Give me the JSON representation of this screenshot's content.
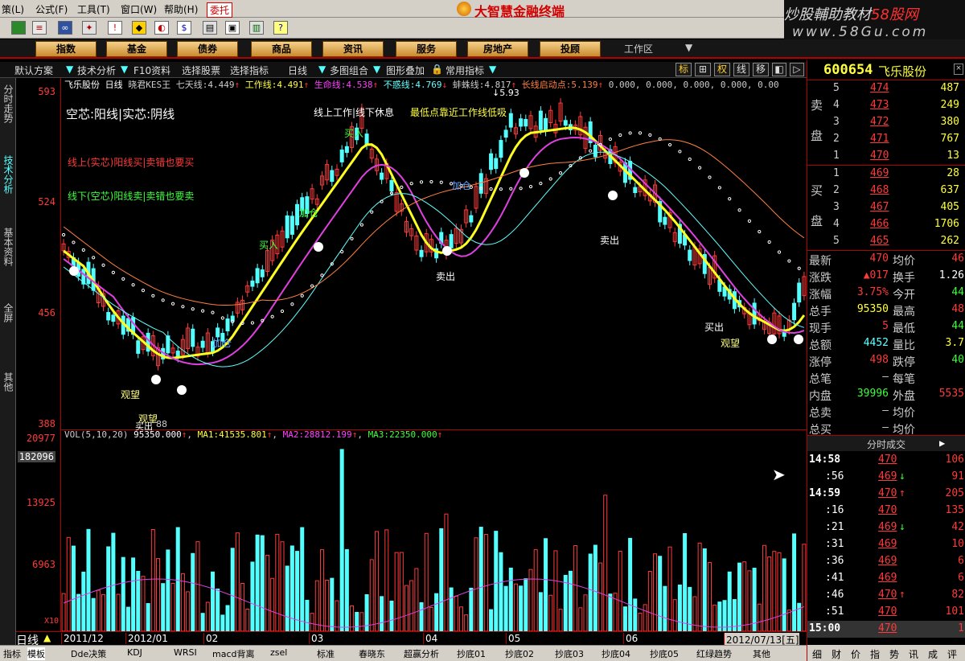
{
  "menubar": {
    "items": [
      "策(L)",
      "公式(F)",
      "工具(T)",
      "窗口(W)",
      "帮助(H)"
    ],
    "sell_tab": "委托",
    "app_title": "大智慧金融终端",
    "watermark_line1a": "炒股輔助教材",
    "watermark_line1b": "58股网",
    "watermark_line2": "www.58Gu.com"
  },
  "navbar": {
    "buttons": [
      "指数",
      "基金",
      "债券",
      "商品",
      "资讯",
      "服务",
      "房地产",
      "投顾"
    ],
    "workspace": "工作区"
  },
  "toolbar2": {
    "items": [
      "默认方案",
      "技术分析",
      "F10资料",
      "选择股票",
      "选择指标",
      "日线",
      "多图组合",
      "图形叠加",
      "常用指标"
    ],
    "right_btns": [
      "标",
      "⊞",
      "权",
      "线",
      "移"
    ]
  },
  "sidebar": {
    "tabs": [
      "分时走势",
      "技术分析",
      "基本资料",
      "全屏",
      "其他"
    ]
  },
  "yaxis": {
    "labels": [
      "593",
      "524",
      "456",
      "388"
    ],
    "vol_labels": [
      "20977",
      "182096",
      "13925",
      "6963",
      "X10"
    ]
  },
  "indicator_line": {
    "name": "飞乐股份 日线",
    "formula": "晓君KES王",
    "items": [
      {
        "label": "七天线:",
        "value": "4.449",
        "color": "#ccc"
      },
      {
        "label": "工作线:",
        "value": "4.491",
        "color": "#ffff40"
      },
      {
        "label": "生命线:",
        "value": "4.538",
        "color": "#ff40ff"
      },
      {
        "label": "不惑线:",
        "value": "4.769",
        "color": "#60ffff"
      },
      {
        "label": "蚌蛛线:",
        "value": "4.817",
        "color": "#ccc"
      },
      {
        "label": "长线启动点:",
        "value": "5.139",
        "color": "#ff8040"
      }
    ],
    "tail": "0.000, 0.000, 0.000, 0.000, 0.00",
    "marker": "5.93"
  },
  "chart_annotations": {
    "hollow_solid": "空芯:阳线|实芯:阴线",
    "above_below": "线上工作|线下休息",
    "lowest_point": "最低点靠近工作线低吸",
    "line_up": "线上(实芯)阳线买|卖错也要买",
    "line_down": "线下(空芯)阳线卖|卖错也要卖",
    "labels": [
      "卖出",
      "卖出",
      "观望",
      "观望",
      "观望",
      "买出",
      "买入",
      "买入",
      "加仓",
      "加仓",
      "加仓",
      "买出",
      "88"
    ]
  },
  "volume": {
    "label": "VOL(5,10,20)",
    "value": "95350.000",
    "ma1_label": "MA1:",
    "ma1": "41535.801",
    "ma2_label": "MA2:",
    "ma2": "28812.199",
    "ma3_label": "MA3:",
    "ma3": "22350.000"
  },
  "xaxis": {
    "period": "日线",
    "labels": [
      "2011/12",
      "2012/01",
      "02",
      "03",
      "04",
      "05",
      "06",
      "2012/07/13[五]"
    ]
  },
  "bottom_tabs": [
    "指标",
    "模板",
    "Dde决策",
    "KDJ",
    "WRSI",
    "macd背离",
    "zsel",
    "标准",
    "春晓东",
    "超赢分析",
    "抄底01",
    "抄底02",
    "抄底03",
    "抄底04",
    "抄底05",
    "红绿趋势",
    "其他"
  ],
  "quote": {
    "code": "600654",
    "name": "飞乐股份",
    "sell_label": [
      "卖",
      "盘"
    ],
    "buy_label": [
      "买",
      "盘"
    ],
    "asks": [
      {
        "lvl": "5",
        "price": "474",
        "vol": "487"
      },
      {
        "lvl": "4",
        "price": "473",
        "vol": "249"
      },
      {
        "lvl": "3",
        "price": "472",
        "vol": "380"
      },
      {
        "lvl": "2",
        "price": "471",
        "vol": "767"
      },
      {
        "lvl": "1",
        "price": "470",
        "vol": "13"
      }
    ],
    "bids": [
      {
        "lvl": "1",
        "price": "469",
        "vol": "28"
      },
      {
        "lvl": "2",
        "price": "468",
        "vol": "637"
      },
      {
        "lvl": "3",
        "price": "467",
        "vol": "405"
      },
      {
        "lvl": "4",
        "price": "466",
        "vol": "1706"
      },
      {
        "lvl": "5",
        "price": "465",
        "vol": "262"
      }
    ],
    "stats": [
      {
        "l1": "最新",
        "v1": "470",
        "c1": "redv",
        "l2": "均价",
        "v2": "46",
        "c2": "redv"
      },
      {
        "l1": "涨跌",
        "v1": "▲017",
        "c1": "redv",
        "l2": "换手",
        "v2": "1.26",
        "c2": "whv"
      },
      {
        "l1": "涨幅",
        "v1": "3.75%",
        "c1": "redv",
        "l2": "今开",
        "v2": "44",
        "c2": "grnv"
      },
      {
        "l1": "总手",
        "v1": "95350",
        "c1": "yelv",
        "l2": "最高",
        "v2": "48",
        "c2": "redv"
      },
      {
        "l1": "现手",
        "v1": "5",
        "c1": "redv",
        "l2": "最低",
        "v2": "44",
        "c2": "grnv"
      },
      {
        "l1": "总额",
        "v1": "4452",
        "c1": "cyv",
        "l2": "量比",
        "v2": "3.7",
        "c2": "yelv"
      },
      {
        "l1": "涨停",
        "v1": "498",
        "c1": "redv",
        "l2": "跌停",
        "v2": "40",
        "c2": "grnv"
      },
      {
        "l1": "总笔",
        "v1": "–",
        "c1": "gryv",
        "l2": "每笔",
        "v2": "",
        "c2": "gryv"
      },
      {
        "l1": "内盘",
        "v1": "39996",
        "c1": "grnv",
        "l2": "外盘",
        "v2": "5535",
        "c2": "redv"
      },
      {
        "l1": "总卖",
        "v1": "–",
        "c1": "gryv",
        "l2": "均价",
        "v2": "",
        "c2": "gryv"
      },
      {
        "l1": "总买",
        "v1": "–",
        "c1": "gryv",
        "l2": "均价",
        "v2": "",
        "c2": "gryv"
      }
    ],
    "ticks_title": "分时成交",
    "ticks": [
      {
        "t": "14:58",
        "p": "470",
        "arrow": "",
        "v": "106",
        "bold": true
      },
      {
        "t": ":56",
        "p": "469",
        "arrow": "↓",
        "v": "91",
        "bold": false
      },
      {
        "t": "14:59",
        "p": "470",
        "arrow": "↑",
        "v": "205",
        "bold": true
      },
      {
        "t": ":16",
        "p": "470",
        "arrow": "",
        "v": "135",
        "bold": false
      },
      {
        "t": ":21",
        "p": "469",
        "arrow": "↓",
        "v": "42",
        "bold": false
      },
      {
        "t": ":31",
        "p": "469",
        "arrow": "",
        "v": "10",
        "bold": false
      },
      {
        "t": ":36",
        "p": "469",
        "arrow": "",
        "v": "6",
        "bold": false
      },
      {
        "t": ":41",
        "p": "469",
        "arrow": "",
        "v": "6",
        "bold": false
      },
      {
        "t": ":46",
        "p": "470",
        "arrow": "↑",
        "v": "82",
        "bold": false
      },
      {
        "t": ":51",
        "p": "470",
        "arrow": "",
        "v": "101",
        "bold": false
      },
      {
        "t": "15:00",
        "p": "470",
        "arrow": "",
        "v": "1",
        "bold": true
      }
    ],
    "bottom_tabs": [
      "细",
      "财",
      "价",
      "指",
      "势",
      "讯",
      "成",
      "评"
    ]
  },
  "colors": {
    "up": "#ff3a3a",
    "down": "#54ffff",
    "work_line": "#ffff20",
    "life_line": "#e040e0",
    "long_line": "#ff8040",
    "dot_line": "#ffffff"
  }
}
